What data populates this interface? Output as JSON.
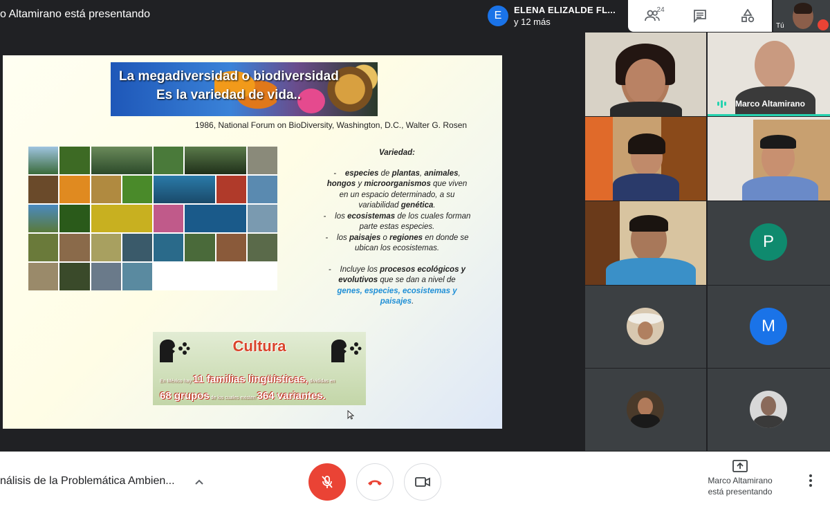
{
  "header": {
    "presenting_title": "o Altamirano está presentando",
    "people": {
      "avatar_letter": "E",
      "name": "ELENA ELIZALDE FL...",
      "others": "y 12 más"
    },
    "participants_count": "24",
    "self_label": "Tú"
  },
  "slide": {
    "banner_line1": "La megadiversidad  o biodiversidad",
    "banner_line2": "Es la variedad de vida..",
    "citation": "1986, National Forum on BioDiversity, Washington, D.C., Walter G. Rosen",
    "variedad": {
      "title": "Variedad:",
      "item1_dash": "-",
      "item1_a": "especies",
      "item1_b": " de ",
      "item1_c": "plantas",
      "item1_d": ", ",
      "item1_e": "animales",
      "item1_f": ",",
      "item1_g": "hongos",
      "item1_h": " y ",
      "item1_i": "microorganismos",
      "item1_j": " que viven",
      "item1_k": "en un espacio determinado, a su",
      "item1_l": "variabilidad ",
      "item1_m": "genética",
      "item1_n": ".",
      "item2_dash": "-",
      "item2_a": "los ",
      "item2_b": "ecosistemas",
      "item2_c": " de los cuales forman",
      "item2_d": "parte estas especies.",
      "item3_dash": "-",
      "item3_a": "los ",
      "item3_b": "paisajes",
      "item3_c": " o ",
      "item3_d": "regiones",
      "item3_e": " en donde se",
      "item3_f": "ubican los ecosistemas.",
      "item4_dash": "-",
      "item4_a": "Incluye los ",
      "item4_b": "procesos ecológicos y",
      "item4_c": "evolutivos",
      "item4_d": " que se dan a nivel de",
      "item4_e": "genes, especies, ecosistemas y",
      "item4_f": "paisajes",
      "item4_g": "."
    },
    "cultura": {
      "title": "Cultura",
      "l1_small_a": "En México hay ",
      "l1_big": "11 familias lingüísticas,",
      "l1_small_b": " divididas en",
      "l2_big_a": "68 grupos",
      "l2_small": " de los cuales existen ",
      "l2_big_b": "364 variantes",
      "l2_end": "."
    }
  },
  "participants": {
    "speaker_name": "Marco Altamirano",
    "avatar_p": "P",
    "avatar_m": "M",
    "color_p": "#0f8a6e",
    "color_m": "#1a73e8"
  },
  "footer": {
    "meeting_title": "nálisis de la Problemática Ambien...",
    "presenting_line1": "Marco Altamirano",
    "presenting_line2": "está presentando"
  },
  "colors": {
    "hangup": "#ea4335",
    "accent": "#1a73e8"
  }
}
